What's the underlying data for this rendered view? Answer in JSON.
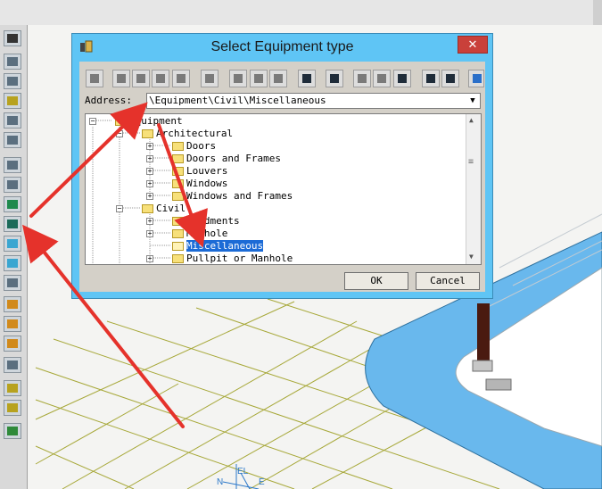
{
  "dialog": {
    "title": "Select Equipment type",
    "close_symbol": "✕",
    "address_label": "Address:",
    "address_value": "\\Equipment\\Civil\\Miscellaneous",
    "ok_label": "OK",
    "cancel_label": "Cancel"
  },
  "tree": {
    "root": "Equipment",
    "nodes": [
      {
        "label": "Architectural",
        "level": 1
      },
      {
        "label": "Doors",
        "level": 2
      },
      {
        "label": "Doors and Frames",
        "level": 2
      },
      {
        "label": "Louvers",
        "level": 2
      },
      {
        "label": "Windows",
        "level": 2
      },
      {
        "label": "Windows and Frames",
        "level": 2
      },
      {
        "label": "Civil",
        "level": 1
      },
      {
        "label": "Abedments",
        "level": 2
      },
      {
        "label": "Manhole",
        "level": 2
      },
      {
        "label": "Miscellaneous",
        "level": 2,
        "selected": true
      },
      {
        "label": "Pullpit or Manhole",
        "level": 2
      }
    ]
  },
  "toolbar_icons": [
    "save-icon",
    "cut-icon",
    "copy-icon",
    "paste-icon",
    "delete-icon",
    "undo-icon",
    "insert-icon",
    "move-up-icon",
    "move-down-icon",
    "properties-icon",
    "new-window-icon",
    "filter-icon",
    "sort-icon",
    "trash-icon",
    "list-view-icon",
    "details-view-icon",
    "back-icon"
  ],
  "viewport_axis_labels": {
    "elevation": "EL",
    "north": "N",
    "east": "E"
  },
  "colors": {
    "dialog_frame": "#5fc5f5",
    "dialog_client": "#d4d0c8",
    "selection": "#1c6bd6",
    "close_button": "#c9403a",
    "arrow": "#e5322b",
    "grid": "#a7a839",
    "slab_edge": "#69b8ed"
  }
}
